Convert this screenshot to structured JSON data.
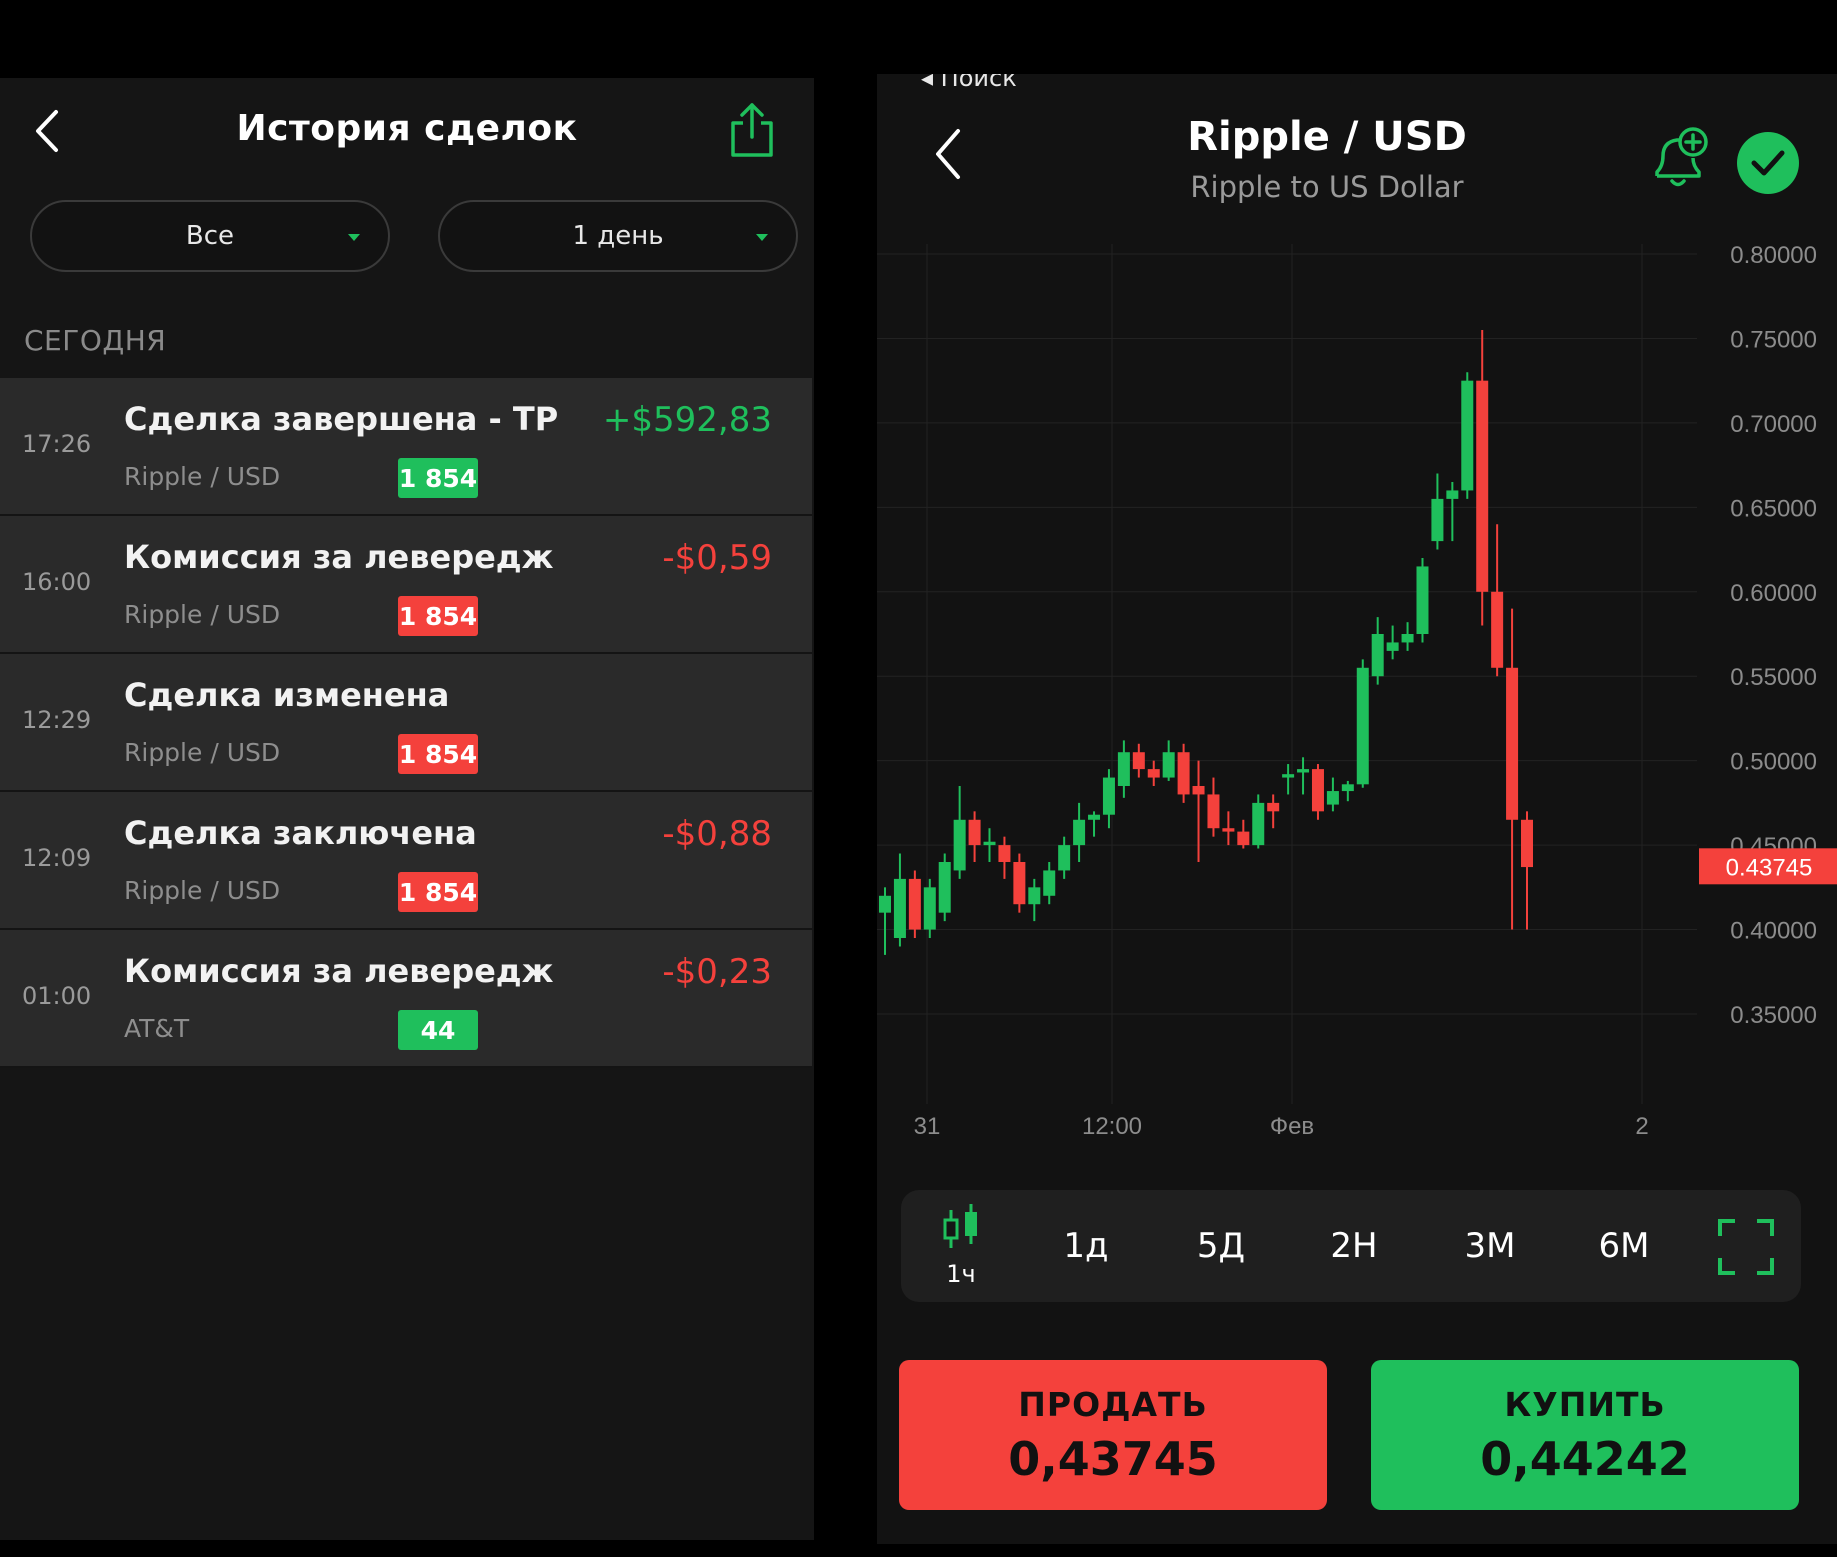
{
  "history": {
    "title": "История сделок",
    "filter_type": "Все",
    "filter_period": "1 день",
    "section": "СЕГОДНЯ",
    "rows": [
      {
        "time": "17:26",
        "name": "Сделка завершена - TP",
        "symbol": "Ripple / USD",
        "badge": "1 854",
        "badge_color": "#1fbf5c",
        "amount": "+$592,83",
        "amount_color": "#1fbf5c"
      },
      {
        "time": "16:00",
        "name": "Комиссия за левередж",
        "symbol": "Ripple / USD",
        "badge": "1 854",
        "badge_color": "#f4413c",
        "amount": "-$0,59",
        "amount_color": "#f4413c"
      },
      {
        "time": "12:29",
        "name": "Сделка изменена",
        "symbol": "Ripple / USD",
        "badge": "1 854",
        "badge_color": "#f4413c",
        "amount": "",
        "amount_color": "#f4413c"
      },
      {
        "time": "12:09",
        "name": "Сделка заключена",
        "symbol": "Ripple / USD",
        "badge": "1 854",
        "badge_color": "#f4413c",
        "amount": "-$0,88",
        "amount_color": "#f4413c"
      },
      {
        "time": "01:00",
        "name": "Комиссия за левередж",
        "symbol": "AT&T",
        "badge": "44",
        "badge_color": "#1fbf5c",
        "amount": "-$0,23",
        "amount_color": "#f4413c"
      }
    ]
  },
  "instrument": {
    "crumb": "◂ Поиск",
    "title": "Ripple / USD",
    "subtitle": "Ripple to US Dollar"
  },
  "chart_data": {
    "type": "candlestick",
    "y_ticks": [
      "0.80000",
      "0.75000",
      "0.70000",
      "0.65000",
      "0.60000",
      "0.55000",
      "0.50000",
      "0.45000",
      "0.40000",
      "0.35000"
    ],
    "ylim": [
      0.35,
      0.8
    ],
    "x_ticks": [
      "31",
      "12:00",
      "Фев",
      "2"
    ],
    "current_price_label": "0.43745",
    "up_color": "#1fbf5c",
    "down_color": "#f4413c",
    "candles": [
      {
        "o": 0.41,
        "h": 0.425,
        "l": 0.385,
        "c": 0.42
      },
      {
        "o": 0.395,
        "h": 0.445,
        "l": 0.39,
        "c": 0.43
      },
      {
        "o": 0.43,
        "h": 0.435,
        "l": 0.395,
        "c": 0.4
      },
      {
        "o": 0.4,
        "h": 0.43,
        "l": 0.395,
        "c": 0.425
      },
      {
        "o": 0.41,
        "h": 0.445,
        "l": 0.405,
        "c": 0.44
      },
      {
        "o": 0.435,
        "h": 0.485,
        "l": 0.43,
        "c": 0.465
      },
      {
        "o": 0.465,
        "h": 0.47,
        "l": 0.44,
        "c": 0.45
      },
      {
        "o": 0.45,
        "h": 0.46,
        "l": 0.44,
        "c": 0.452
      },
      {
        "o": 0.45,
        "h": 0.455,
        "l": 0.43,
        "c": 0.44
      },
      {
        "o": 0.44,
        "h": 0.445,
        "l": 0.41,
        "c": 0.415
      },
      {
        "o": 0.415,
        "h": 0.43,
        "l": 0.405,
        "c": 0.425
      },
      {
        "o": 0.42,
        "h": 0.44,
        "l": 0.415,
        "c": 0.435
      },
      {
        "o": 0.435,
        "h": 0.455,
        "l": 0.43,
        "c": 0.45
      },
      {
        "o": 0.45,
        "h": 0.475,
        "l": 0.44,
        "c": 0.465
      },
      {
        "o": 0.465,
        "h": 0.47,
        "l": 0.455,
        "c": 0.468
      },
      {
        "o": 0.468,
        "h": 0.495,
        "l": 0.46,
        "c": 0.49
      },
      {
        "o": 0.485,
        "h": 0.512,
        "l": 0.478,
        "c": 0.505
      },
      {
        "o": 0.505,
        "h": 0.51,
        "l": 0.49,
        "c": 0.495
      },
      {
        "o": 0.495,
        "h": 0.5,
        "l": 0.485,
        "c": 0.49
      },
      {
        "o": 0.49,
        "h": 0.512,
        "l": 0.488,
        "c": 0.505
      },
      {
        "o": 0.505,
        "h": 0.51,
        "l": 0.475,
        "c": 0.48
      },
      {
        "o": 0.485,
        "h": 0.5,
        "l": 0.44,
        "c": 0.48
      },
      {
        "o": 0.48,
        "h": 0.49,
        "l": 0.455,
        "c": 0.46
      },
      {
        "o": 0.46,
        "h": 0.47,
        "l": 0.45,
        "c": 0.458
      },
      {
        "o": 0.458,
        "h": 0.465,
        "l": 0.448,
        "c": 0.45
      },
      {
        "o": 0.45,
        "h": 0.48,
        "l": 0.448,
        "c": 0.475
      },
      {
        "o": 0.475,
        "h": 0.48,
        "l": 0.46,
        "c": 0.47
      },
      {
        "o": 0.49,
        "h": 0.498,
        "l": 0.48,
        "c": 0.492
      },
      {
        "o": 0.493,
        "h": 0.502,
        "l": 0.48,
        "c": 0.495
      },
      {
        "o": 0.495,
        "h": 0.498,
        "l": 0.465,
        "c": 0.47
      },
      {
        "o": 0.474,
        "h": 0.49,
        "l": 0.47,
        "c": 0.482
      },
      {
        "o": 0.482,
        "h": 0.488,
        "l": 0.476,
        "c": 0.486
      },
      {
        "o": 0.486,
        "h": 0.56,
        "l": 0.484,
        "c": 0.555
      },
      {
        "o": 0.55,
        "h": 0.585,
        "l": 0.545,
        "c": 0.575
      },
      {
        "o": 0.565,
        "h": 0.58,
        "l": 0.56,
        "c": 0.57
      },
      {
        "o": 0.57,
        "h": 0.582,
        "l": 0.565,
        "c": 0.575
      },
      {
        "o": 0.575,
        "h": 0.62,
        "l": 0.57,
        "c": 0.615
      },
      {
        "o": 0.63,
        "h": 0.67,
        "l": 0.625,
        "c": 0.655
      },
      {
        "o": 0.655,
        "h": 0.665,
        "l": 0.63,
        "c": 0.66
      },
      {
        "o": 0.66,
        "h": 0.73,
        "l": 0.655,
        "c": 0.725
      },
      {
        "o": 0.725,
        "h": 0.755,
        "l": 0.58,
        "c": 0.6
      },
      {
        "o": 0.6,
        "h": 0.64,
        "l": 0.55,
        "c": 0.555
      },
      {
        "o": 0.555,
        "h": 0.59,
        "l": 0.4,
        "c": 0.465
      },
      {
        "o": 0.465,
        "h": 0.47,
        "l": 0.4,
        "c": 0.437
      }
    ]
  },
  "timeframes": {
    "active": "1ч",
    "items": [
      "1д",
      "5Д",
      "2Н",
      "3М",
      "6М"
    ]
  },
  "actions": {
    "sell_label": "ПРОДАТЬ",
    "sell_price": "0,43745",
    "buy_label": "КУПИТЬ",
    "buy_price": "0,44242"
  }
}
